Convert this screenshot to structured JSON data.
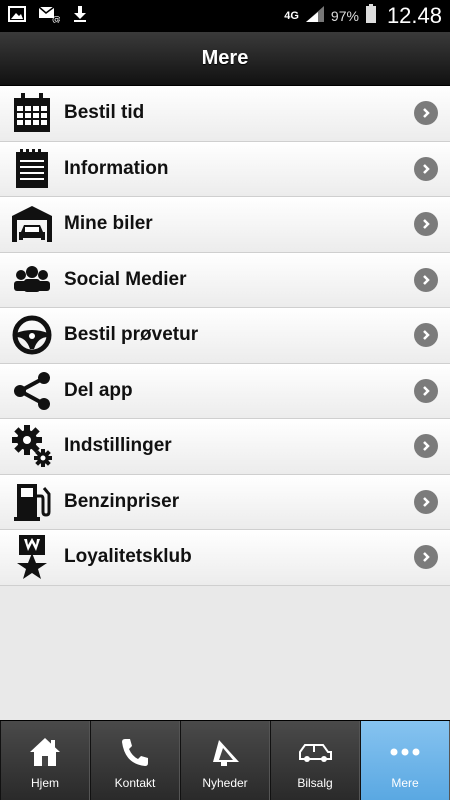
{
  "status_bar": {
    "network": "4G",
    "battery": "97%",
    "time": "12.48"
  },
  "header": {
    "title": "Mere"
  },
  "menu": [
    {
      "label": "Bestil tid",
      "icon": "calendar-icon"
    },
    {
      "label": "Information",
      "icon": "notepad-icon"
    },
    {
      "label": "Mine biler",
      "icon": "garage-icon"
    },
    {
      "label": "Social Medier",
      "icon": "people-icon"
    },
    {
      "label": "Bestil prøvetur",
      "icon": "steering-wheel-icon"
    },
    {
      "label": "Del app",
      "icon": "share-icon"
    },
    {
      "label": "Indstillinger",
      "icon": "gears-icon"
    },
    {
      "label": "Benzinpriser",
      "icon": "fuel-pump-icon"
    },
    {
      "label": "Loyalitetsklub",
      "icon": "medal-star-icon"
    }
  ],
  "tabs": [
    {
      "label": "Hjem",
      "icon": "home-icon"
    },
    {
      "label": "Kontakt",
      "icon": "phone-icon"
    },
    {
      "label": "Nyheder",
      "icon": "megaphone-icon"
    },
    {
      "label": "Bilsalg",
      "icon": "car-icon"
    },
    {
      "label": "Mere",
      "icon": "more-dots-icon",
      "active": true
    }
  ],
  "colors": {
    "active_tab": "#6cb4ea",
    "header": "#1a1a1a"
  }
}
